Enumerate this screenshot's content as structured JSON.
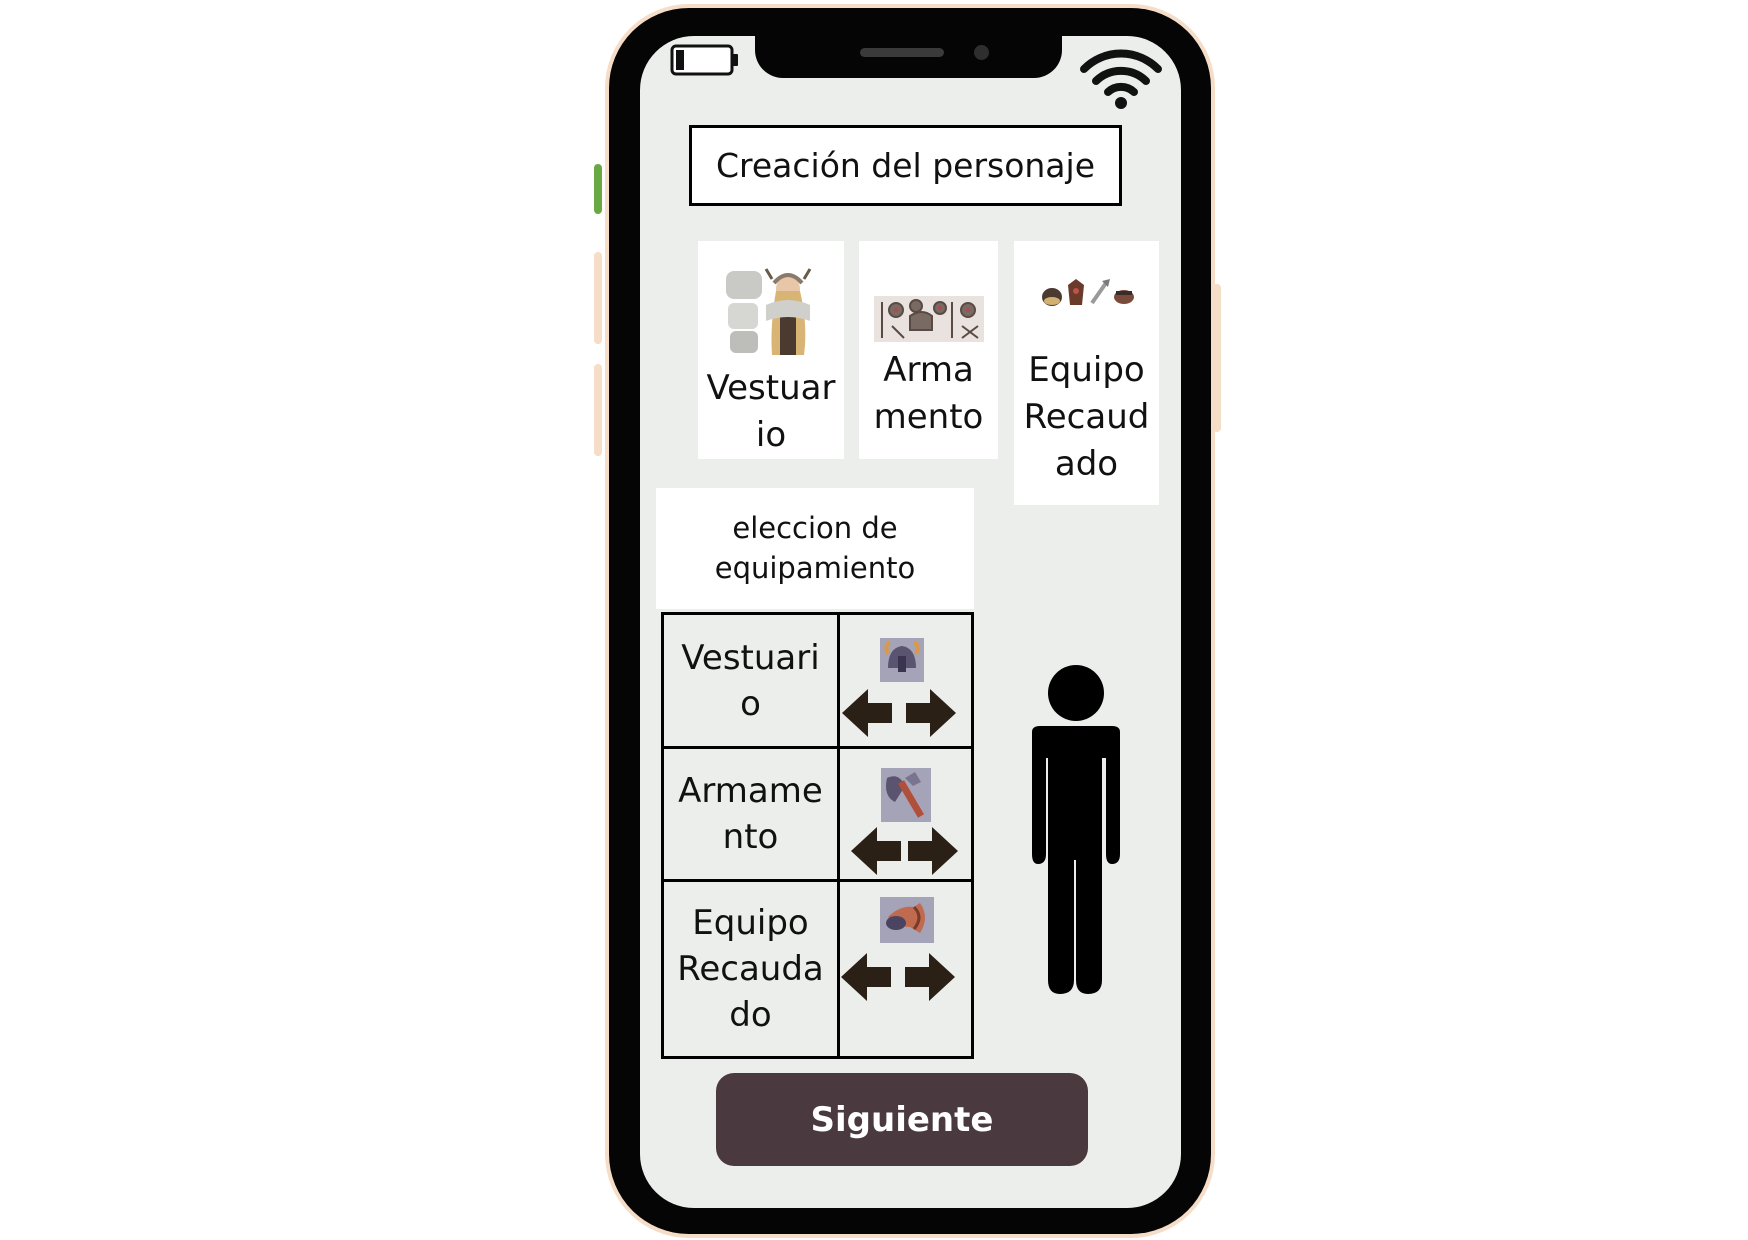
{
  "screen": {
    "title": "Creación del personaje"
  },
  "categories": [
    {
      "label": "Vestuar\nio",
      "thumbnail": "viking-woman-costume-image"
    },
    {
      "label": "Arma\nmento",
      "thumbnail": "viking-weapons-image"
    },
    {
      "label": "Equipo\nRecaud\nado",
      "thumbnail": "viking-gear-image"
    }
  ],
  "selection": {
    "heading": "eleccion de\nequipamiento",
    "rows": [
      {
        "label": "Vestuari\no",
        "icon": "viking-helmet-icon"
      },
      {
        "label": "Armame\nnto",
        "icon": "axe-icon"
      },
      {
        "label": "Equipo\nRecauda\ndo",
        "icon": "drinking-horn-icon"
      }
    ]
  },
  "actions": {
    "next_label": "Siguiente"
  },
  "colors": {
    "next_button": "#4a3a3f",
    "screen_background": "#eceeec",
    "arrow": "#2b2016"
  }
}
